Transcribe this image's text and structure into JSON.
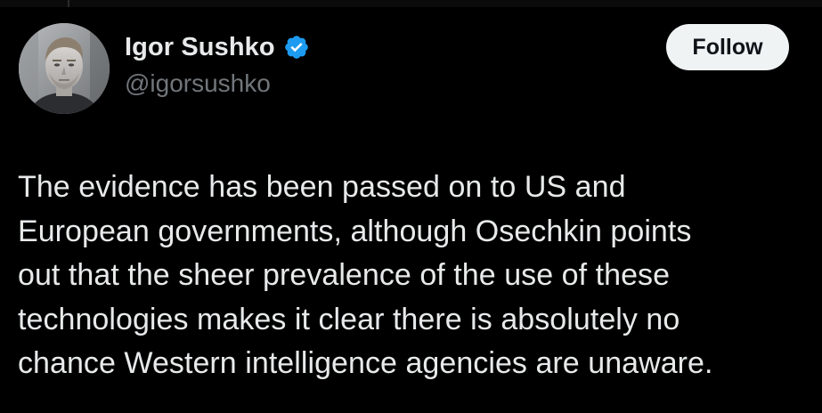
{
  "author": {
    "display_name": "Igor Sushko",
    "handle": "@igorsushko",
    "verified_icon": "verified-badge-icon",
    "avatar_icon": "profile-photo"
  },
  "actions": {
    "follow_label": "Follow"
  },
  "tweet": {
    "lines": [
      "The evidence has been passed on to US and",
      "European governments, although Osechkin points",
      "out that the sheer prevalence of the use of these",
      "technologies makes it clear there is absolutely no",
      "chance Western intelligence agencies are unaware."
    ]
  },
  "colors": {
    "background": "#000000",
    "text_primary": "#e7e9ea",
    "text_secondary": "#71767b",
    "verified_blue": "#1d9bf0",
    "follow_bg": "#eff3f4",
    "follow_text": "#0f1419"
  }
}
